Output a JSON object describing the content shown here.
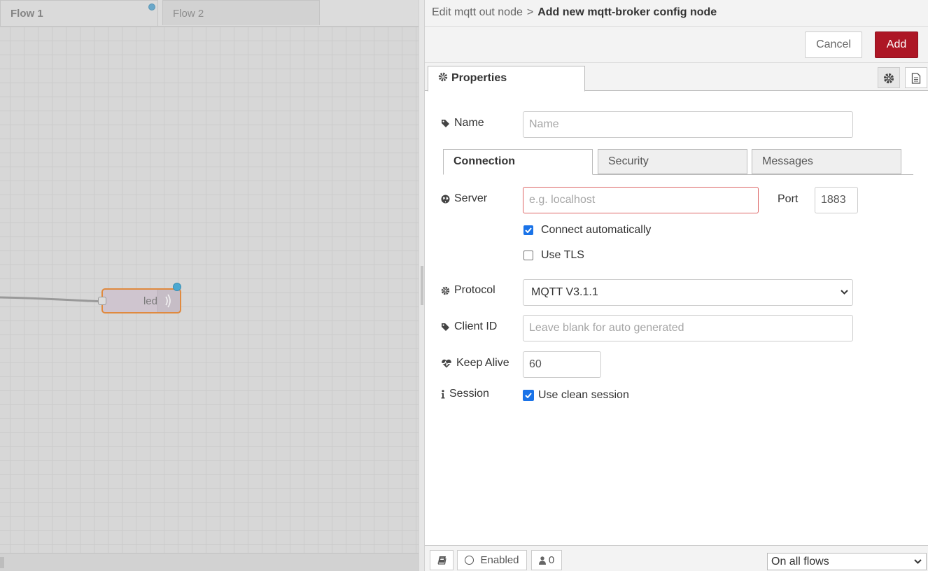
{
  "workspace": {
    "tabs": [
      {
        "label": "Flow 1",
        "active": true,
        "changed": true
      },
      {
        "label": "Flow 2",
        "active": false
      }
    ],
    "nodes": [
      {
        "label": "led",
        "type": "mqtt out"
      }
    ]
  },
  "tray": {
    "breadcrumb": "Edit mqtt out node",
    "breadcrumb_separator": ">",
    "title": "Add new mqtt-broker config node",
    "cancel_label": "Cancel",
    "add_label": "Add",
    "properties_tab": "Properties",
    "form": {
      "name_label": "Name",
      "name_placeholder": "Name",
      "subtabs": [
        "Connection",
        "Security",
        "Messages"
      ],
      "server_label": "Server",
      "server_placeholder": "e.g. localhost",
      "port_label": "Port",
      "port_value": "1883",
      "connect_auto_label": "Connect automatically",
      "connect_auto_checked": true,
      "use_tls_label": "Use TLS",
      "use_tls_checked": false,
      "protocol_label": "Protocol",
      "protocol_value": "MQTT V3.1.1",
      "client_id_label": "Client ID",
      "client_id_placeholder": "Leave blank for auto generated",
      "keep_alive_label": "Keep Alive",
      "keep_alive_value": "60",
      "session_label": "Session",
      "clean_session_label": "Use clean session",
      "clean_session_checked": true
    },
    "footer": {
      "enabled_label": "Enabled",
      "users_count": "0",
      "scope_value": "On all flows"
    }
  },
  "colors": {
    "add_button": "#ad1625",
    "checkbox": "#1a73e8",
    "node_border": "#e08a3f",
    "status_dot": "#4ca8d0"
  },
  "icons": [
    "gear-icon",
    "file-text-icon",
    "tag-icon",
    "globe-icon",
    "heartbeat-icon",
    "info-icon",
    "book-icon",
    "user-icon",
    "chevron-down-icon",
    "broadcast-icon"
  ]
}
